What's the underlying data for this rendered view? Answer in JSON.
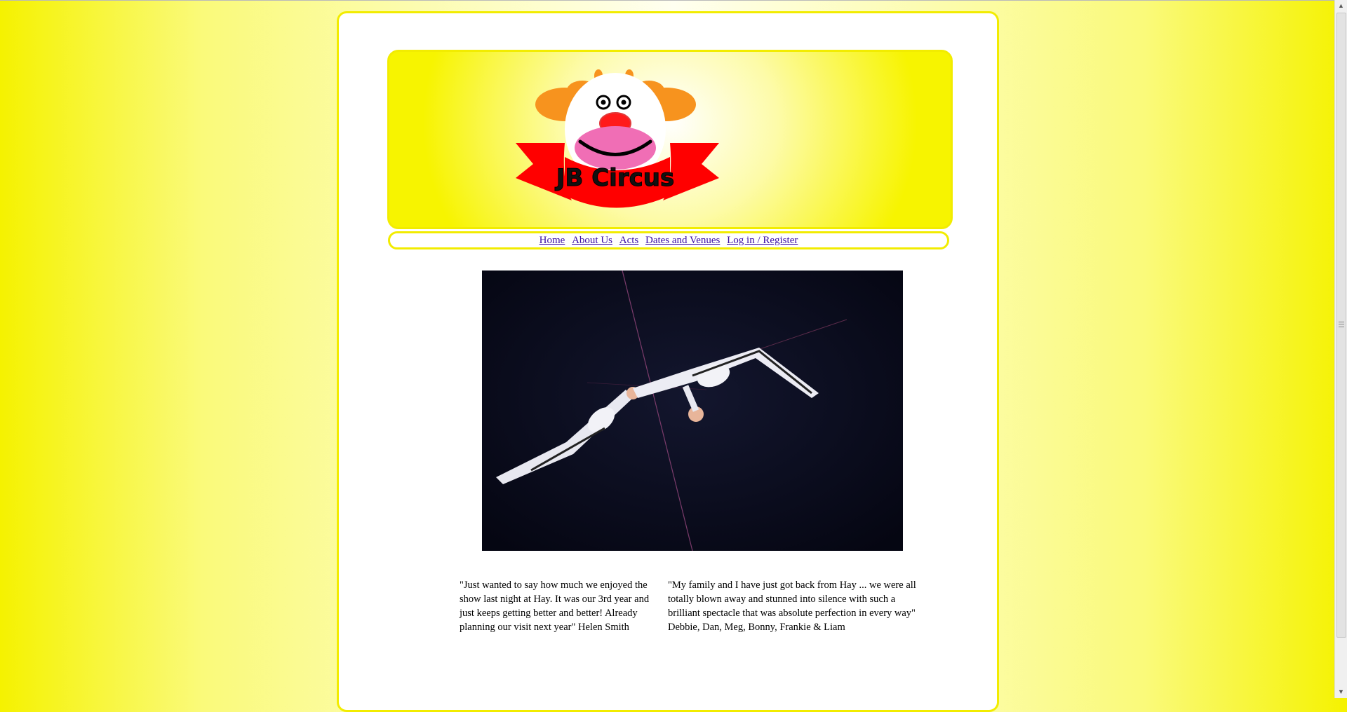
{
  "logo": {
    "text": "JB Circus"
  },
  "nav": {
    "items": [
      {
        "label": "Home"
      },
      {
        "label": "About Us"
      },
      {
        "label": "Acts"
      },
      {
        "label": "Dates and Venues"
      },
      {
        "label": "Log in / Register"
      }
    ]
  },
  "photo": {
    "subject": "trapeze-artists"
  },
  "testimonials": [
    {
      "text": "\"Just wanted to say how much we enjoyed the show last night at Hay. It was our 3rd year and just keeps getting better and better! Already planning our visit next year\" Helen Smith"
    },
    {
      "text": "\"My family and I have just got back from Hay ... we were all totally blown away and stunned into silence with such a brilliant spectacle that was absolute perfection in every way\" Debbie, Dan, Meg, Bonny, Frankie & Liam"
    }
  ],
  "colors": {
    "accent_yellow": "#f2ec00",
    "link": "#3a0ca3",
    "ribbon_red": "#ff0000",
    "clown_orange": "#f7931e",
    "clown_pink": "#f06eb5"
  }
}
